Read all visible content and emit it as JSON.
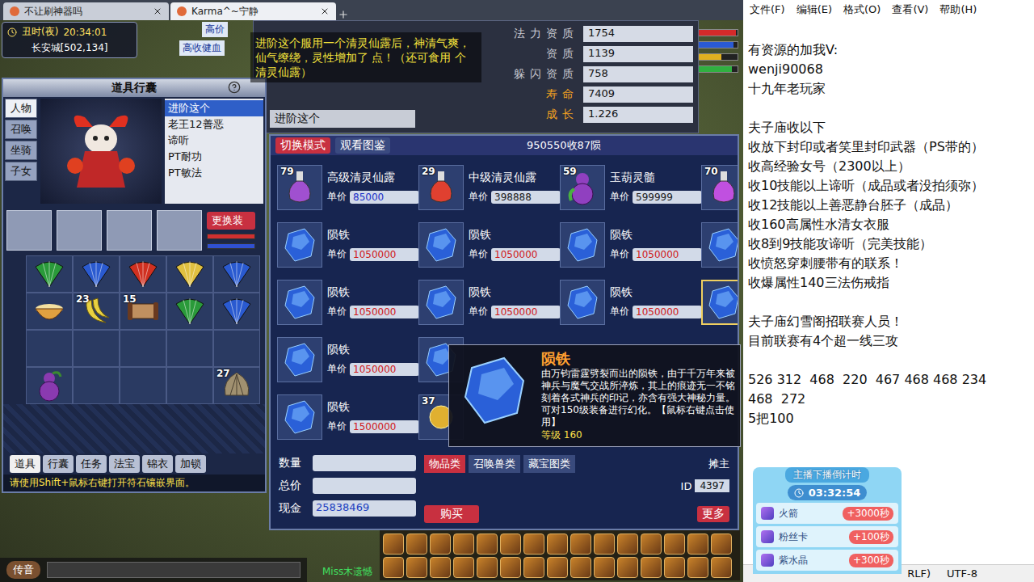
{
  "browser_tabs": [
    {
      "label": "不让刷神器吗",
      "selected": false
    },
    {
      "label": "Karma^~宁静",
      "selected": true
    }
  ],
  "hud": {
    "time": "丑时(夜)",
    "clock": "20:34:01",
    "location": "长安城[502,134]"
  },
  "scene_labels": [
    "高收健血",
    "高价",
    "Miss木遗憾"
  ],
  "status_bars": [
    {
      "color": "#d42a2a",
      "level": 0.95
    },
    {
      "color": "#2a5ad4",
      "level": 0.9
    },
    {
      "color": "#e0b020",
      "level": 0.6
    },
    {
      "color": "#30b040",
      "level": 0.85
    }
  ],
  "inventory": {
    "title": "道具行囊",
    "side_tabs": [
      {
        "label": "人物",
        "selected": true
      },
      {
        "label": "召唤",
        "selected": false
      },
      {
        "label": "坐骑",
        "selected": false
      },
      {
        "label": "子女",
        "selected": false
      }
    ],
    "pets": [
      {
        "label": "进阶这个",
        "selected": true
      },
      {
        "label": "老王12善恶",
        "selected": false
      },
      {
        "label": "谛听",
        "selected": false
      },
      {
        "label": "PT耐功",
        "selected": false
      },
      {
        "label": "PT敏法",
        "selected": false
      }
    ],
    "change_button": "更换装",
    "grid": [
      {
        "kind": "fan",
        "color": "#2a9a3a",
        "count": ""
      },
      {
        "kind": "fan",
        "color": "#2a5ad0",
        "count": ""
      },
      {
        "kind": "fan",
        "color": "#d03020",
        "count": ""
      },
      {
        "kind": "fan",
        "color": "#e0c040",
        "count": ""
      },
      {
        "kind": "fan",
        "color": "#2a5ad0",
        "count": ""
      },
      {
        "kind": "bowl",
        "color": "#e0a040",
        "count": ""
      },
      {
        "kind": "banana",
        "color": "#e8d040",
        "count": "23"
      },
      {
        "kind": "scroll",
        "color": "#c09060",
        "count": "15"
      },
      {
        "kind": "fan",
        "color": "#2a9a3a",
        "count": ""
      },
      {
        "kind": "fan",
        "color": "#2a5ad0",
        "count": ""
      },
      {
        "kind": "empty",
        "color": "",
        "count": ""
      },
      {
        "kind": "empty",
        "color": "",
        "count": ""
      },
      {
        "kind": "empty",
        "color": "",
        "count": ""
      },
      {
        "kind": "empty",
        "color": "",
        "count": ""
      },
      {
        "kind": "empty",
        "color": "",
        "count": ""
      },
      {
        "kind": "gourd",
        "color": "#8a3ab0",
        "count": ""
      },
      {
        "kind": "empty",
        "color": "",
        "count": ""
      },
      {
        "kind": "empty",
        "color": "",
        "count": ""
      },
      {
        "kind": "empty",
        "color": "",
        "count": ""
      },
      {
        "kind": "shell",
        "color": "#a09070",
        "count": "27"
      }
    ],
    "bottom_tabs": [
      {
        "label": "道具",
        "selected": true
      },
      {
        "label": "行囊",
        "selected": false
      },
      {
        "label": "任务",
        "selected": false
      },
      {
        "label": "法宝",
        "selected": false
      },
      {
        "label": "锦衣",
        "selected": false
      },
      {
        "label": "加锁",
        "selected": false
      }
    ],
    "hint": "请使用Shift+鼠标右键打开符石镶嵌界面。"
  },
  "pet_stats": {
    "name_box": "进阶这个",
    "rows": [
      {
        "label": "法力资质",
        "value": "1754",
        "color": "#c8c8d0"
      },
      {
        "label": "资质",
        "value": "1139",
        "color": "#c8c8d0"
      },
      {
        "label": "躲闪资质",
        "value": "758",
        "color": "#c8c8d0"
      },
      {
        "label": "寿命",
        "value": "7409",
        "color": "#f0a020"
      },
      {
        "label": "成长",
        "value": "1.226",
        "color": "#f0a020"
      }
    ]
  },
  "message": "进阶这个服用一个清灵仙露后，神清气爽，仙气缭绕，灵性增加了 点！（还可食用 个清灵仙露）",
  "market": {
    "mode_button": "切换模式",
    "catalog_button": "观看图鉴",
    "title": "950550收87陨",
    "price_label": "单价",
    "items": [
      {
        "kind": "vial",
        "color": "#a050d0",
        "count": "79",
        "name": "高级清灵仙露",
        "price": "85000",
        "price_color": "#1a30c8",
        "selected": false
      },
      {
        "kind": "vial",
        "color": "#e04030",
        "count": "29",
        "name": "中级清灵仙露",
        "price": "398888",
        "price_color": "#202020",
        "selected": false
      },
      {
        "kind": "gourd",
        "color": "#9040c0",
        "count": "59",
        "name": "玉葫灵髓",
        "price": "599999",
        "price_color": "#202020",
        "selected": false
      },
      {
        "kind": "vial",
        "color": "#c050e0",
        "count": "70",
        "name": "",
        "price": "",
        "price_color": "",
        "selected": false
      },
      {
        "kind": "ore",
        "color": "#2a60d8",
        "count": "",
        "name": "陨铁",
        "price": "1050000",
        "price_color": "#d01818",
        "selected": false
      },
      {
        "kind": "ore",
        "color": "#2a60d8",
        "count": "",
        "name": "陨铁",
        "price": "1050000",
        "price_color": "#d01818",
        "selected": false
      },
      {
        "kind": "ore",
        "color": "#2a60d8",
        "count": "",
        "name": "陨铁",
        "price": "1050000",
        "price_color": "#d01818",
        "selected": false
      },
      {
        "kind": "ore",
        "color": "#2a60d8",
        "count": "",
        "name": "",
        "price": "",
        "price_color": "",
        "selected": false
      },
      {
        "kind": "ore",
        "color": "#2a60d8",
        "count": "",
        "name": "陨铁",
        "price": "1050000",
        "price_color": "#d01818",
        "selected": false
      },
      {
        "kind": "ore",
        "color": "#2a60d8",
        "count": "",
        "name": "陨铁",
        "price": "1050000",
        "price_color": "#d01818",
        "selected": false
      },
      {
        "kind": "ore",
        "color": "#2a60d8",
        "count": "",
        "name": "陨铁",
        "price": "1050000",
        "price_color": "#d01818",
        "selected": false
      },
      {
        "kind": "ore",
        "color": "#2a60d8",
        "count": "",
        "name": "",
        "price": "",
        "price_color": "",
        "selected": true
      },
      {
        "kind": "ore",
        "color": "#2a60d8",
        "count": "",
        "name": "陨铁",
        "price": "1050000",
        "price_color": "#d01818",
        "selected": false
      },
      {
        "kind": "ore",
        "color": "#2a60d8",
        "count": "",
        "name": "",
        "price": "",
        "price_color": "",
        "selected": false
      },
      {
        "kind": "empty",
        "color": "",
        "count": "",
        "name": "",
        "price": "",
        "price_color": "",
        "selected": false
      },
      {
        "kind": "empty",
        "color": "",
        "count": "",
        "name": "",
        "price": "",
        "price_color": "",
        "selected": false
      },
      {
        "kind": "ore",
        "color": "#2a60d8",
        "count": "",
        "name": "陨铁",
        "price": "1500000",
        "price_color": "#d01818",
        "selected": false
      },
      {
        "kind": "ball",
        "color": "#e0b030",
        "count": "37",
        "name": "",
        "price": "",
        "price_color": "",
        "selected": false
      },
      {
        "kind": "empty",
        "color": "",
        "count": "",
        "name": "",
        "price": "",
        "price_color": "",
        "selected": false
      },
      {
        "kind": "empty",
        "color": "",
        "count": "",
        "name": "",
        "price": "",
        "price_color": "",
        "selected": false
      }
    ],
    "footer": {
      "quantity_label": "数量",
      "total_label": "总价",
      "cash_label": "现金",
      "cash": "25838469",
      "buy": "购买",
      "categories": [
        {
          "label": "物品类",
          "selected": true
        },
        {
          "label": "召唤兽类",
          "selected": false
        },
        {
          "label": "藏宝图类",
          "selected": false
        }
      ],
      "owner": "摊主",
      "id_label": "ID",
      "id": "4397",
      "more": "更多"
    }
  },
  "tooltip": {
    "title": "陨铁",
    "description": "由万钧雷霆劈裂而出的陨铁，由于千万年来被神兵与魔气交战所淬炼，其上的痕迹无一不铭刻着各式神兵的印记，亦含有强大神秘力量。可对150级装备进行幻化。【鼠标右键点击使用】",
    "level_label": "等级",
    "level": "160"
  },
  "chat": {
    "voice_button": "传音"
  },
  "notepad": {
    "menu": [
      "文件(F)",
      "编辑(E)",
      "格式(O)",
      "查看(V)",
      "帮助(H)"
    ],
    "lines": [
      "有资源的加我V:",
      "wenji90068",
      "十九年老玩家",
      "",
      "夫子庙收以下",
      "收放下封印或者笑里封印武器（PS带的）",
      "收高经验女号（2300以上）",
      "收10技能以上谛听（成品或者没拍须弥）",
      "收12技能以上善恶静台胚子（成品）",
      "收160高属性水清女衣服",
      "收8到9技能攻谛听（完美技能）",
      "收愤怒穿刺腰带有的联系！",
      "收爆属性140三法伤戒指",
      "",
      "夫子庙幻雪阁招联赛人员！",
      "目前联赛有4个超一线三攻",
      "",
      "526 312  468  220  467 468 468 234",
      "468  272",
      "5把100"
    ],
    "status": [
      "RLF)",
      "UTF-8"
    ]
  },
  "countdown": {
    "title": "主播下播倒计时",
    "time": "03:32:54",
    "gifts": [
      {
        "name": "火箭",
        "bonus": "+3000秒"
      },
      {
        "name": "粉丝卡",
        "bonus": "+100秒"
      },
      {
        "name": "紫水晶",
        "bonus": "+300秒"
      }
    ]
  }
}
